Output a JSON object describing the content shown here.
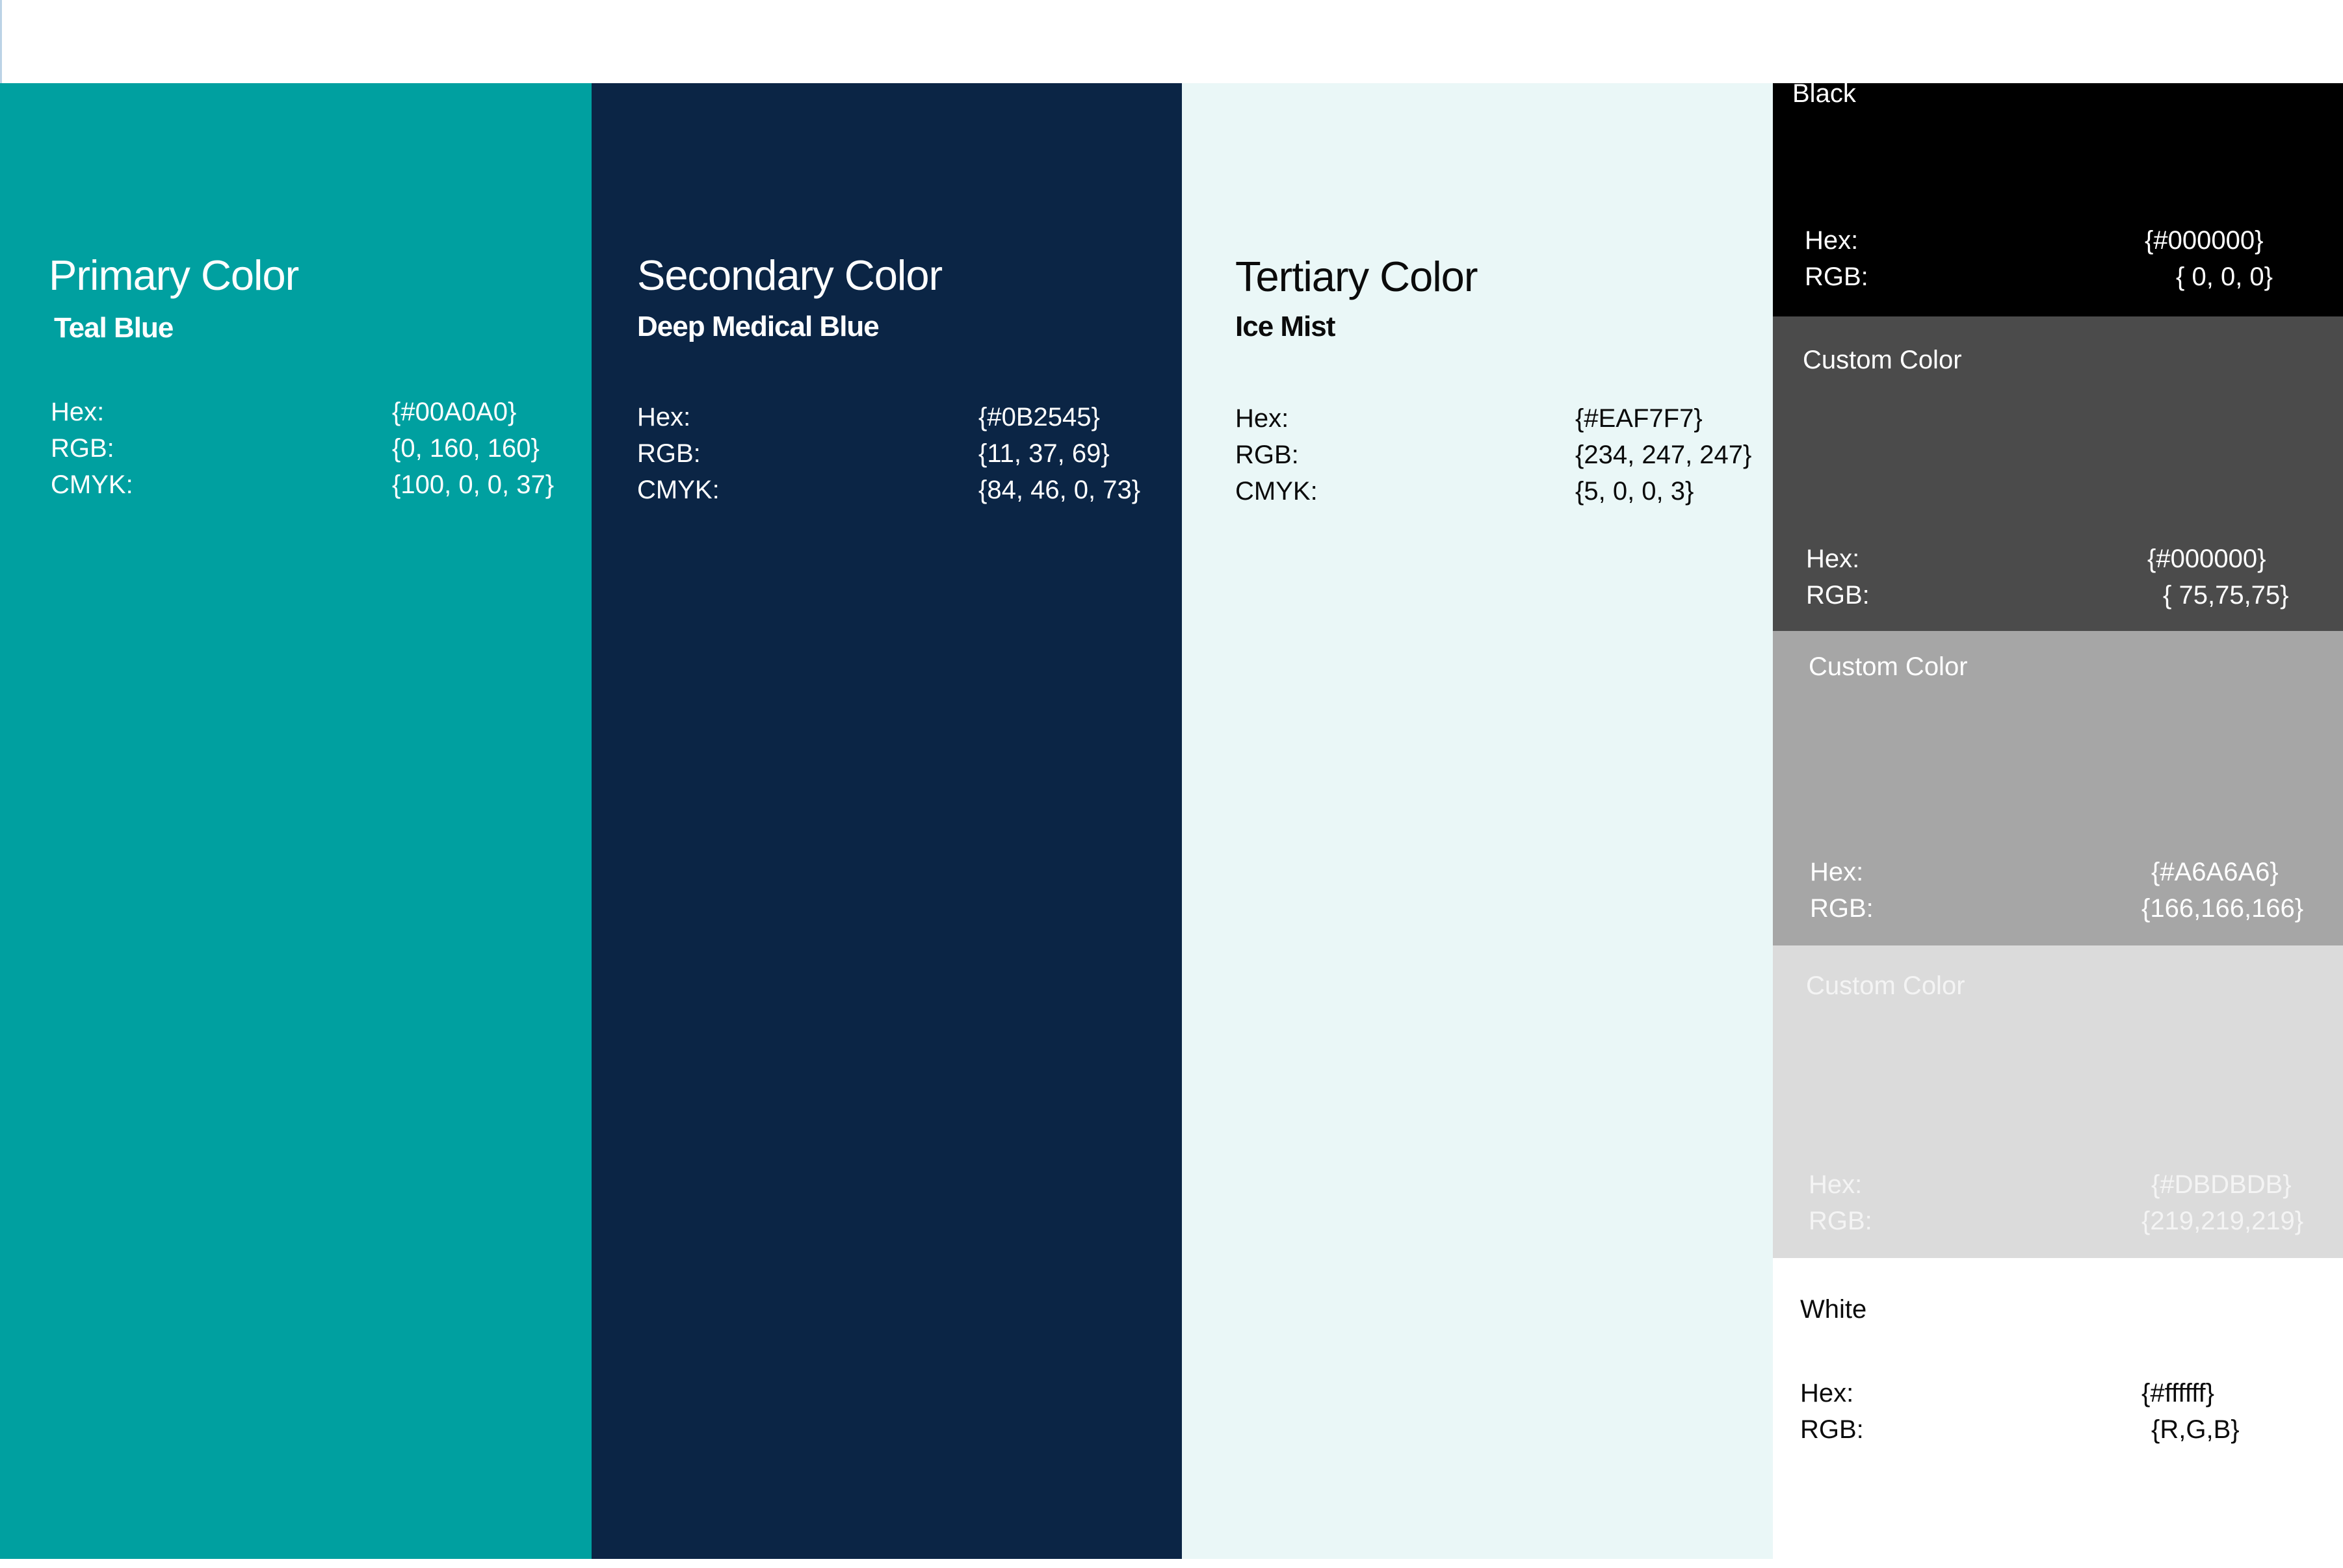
{
  "palette": {
    "primary": {
      "heading": "Primary Color",
      "name": "Teal Blue",
      "hex_label": "Hex:",
      "hex": "{#00A0A0}",
      "rgb_label": "RGB:",
      "rgb": "{0, 160, 160}",
      "cmyk_label": "CMYK:",
      "cmyk": "{100, 0, 0, 37}",
      "color": "#00A0A0"
    },
    "secondary": {
      "heading": "Secondary Color",
      "name": "Deep Medical Blue",
      "hex_label": "Hex:",
      "hex": "{#0B2545}",
      "rgb_label": "RGB:",
      "rgb": "{11, 37, 69}",
      "cmyk_label": "CMYK:",
      "cmyk": "{84, 46, 0, 73}",
      "color": "#0B2545"
    },
    "tertiary": {
      "heading": "Tertiary Color",
      "name": "Ice Mist",
      "hex_label": "Hex:",
      "hex": "{#EAF7F7}",
      "rgb_label": "RGB:",
      "rgb": "{234, 247, 247}",
      "cmyk_label": "CMYK:",
      "cmyk": "{5, 0, 0, 3}",
      "color": "#EAF7F7"
    },
    "swatches": [
      {
        "name": "Black",
        "hex_label": "Hex:",
        "hex": "{#000000}",
        "rgb_label": "RGB:",
        "rgb": "{ 0, 0, 0}",
        "color": "#000000",
        "text_color": "#ffffff"
      },
      {
        "name": "Custom Color",
        "hex_label": "Hex:",
        "hex": "{#000000}",
        "rgb_label": "RGB:",
        "rgb": "{ 75,75,75}",
        "color": "#4B4B4B",
        "text_color": "#ffffff"
      },
      {
        "name": "Custom Color",
        "hex_label": "Hex:",
        "hex": "{#A6A6A6}",
        "rgb_label": "RGB:",
        "rgb": "{166,166,166}",
        "color": "#A6A6A6",
        "text_color": "#ffffff"
      },
      {
        "name": "Custom Color",
        "hex_label": "Hex:",
        "hex": "{#DBDBDB}",
        "rgb_label": "RGB:",
        "rgb": "{219,219,219}",
        "color": "#DBDBDB",
        "text_color": "#f4f4f4"
      },
      {
        "name": "White",
        "hex_label": "Hex:",
        "hex": "{#ffffff}",
        "rgb_label": "RGB:",
        "rgb": "{R,G,B}",
        "color": "#ffffff",
        "text_color": "#0b0b0b"
      }
    ]
  }
}
